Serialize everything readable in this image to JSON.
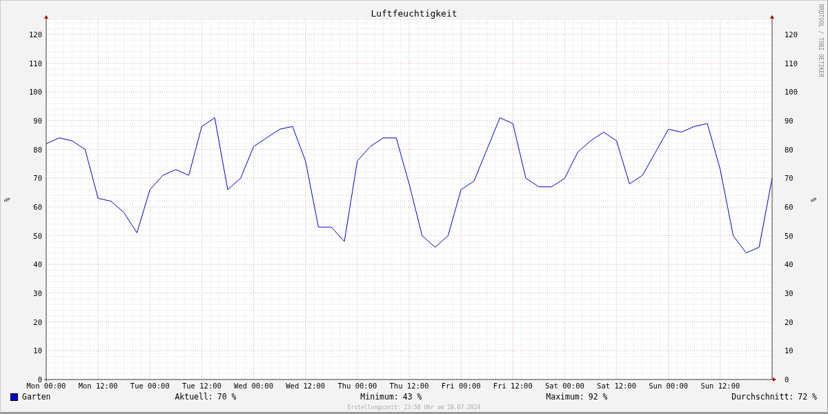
{
  "graph": {
    "title": "Luftfeuchtigkeit",
    "watermark": "RRDTOOL / TOBI OETIKER",
    "right_axis_labels": [
      "120",
      "110",
      "100",
      "90",
      "80",
      "70",
      "60",
      "50",
      "40",
      "30",
      "20",
      "10",
      "0"
    ],
    "chart_data": {
      "type": "line",
      "grid": true,
      "ylabel": "%",
      "ylim": [
        0,
        125
      ],
      "yticks": [
        0,
        10,
        20,
        30,
        40,
        50,
        60,
        70,
        80,
        90,
        100,
        110,
        120
      ],
      "categories": [
        "Mon 00:00",
        null,
        null,
        null,
        "Mon 12:00",
        null,
        null,
        null,
        "Tue 00:00",
        null,
        null,
        null,
        "Tue 12:00",
        null,
        null,
        null,
        "Wed 00:00",
        null,
        null,
        null,
        "Wed 12:00",
        null,
        null,
        null,
        "Thu 00:00",
        null,
        null,
        null,
        "Thu 12:00",
        null,
        null,
        null,
        "Fri 00:00",
        null,
        null,
        null,
        "Fri 12:00",
        null,
        null,
        null,
        "Sat 00:00",
        null,
        null,
        null,
        "Sat 12:00",
        null,
        null,
        null,
        "Sun 00:00",
        null,
        null,
        null,
        "Sun 12:00",
        null,
        null,
        null,
        null
      ],
      "series": [
        {
          "name": "Garten",
          "color": "#0000cc",
          "values": [
            82,
            84,
            83,
            80,
            63,
            62,
            58,
            51,
            66,
            71,
            73,
            71,
            88,
            91,
            66,
            70,
            81,
            84,
            87,
            88,
            76,
            53,
            53,
            48,
            76,
            81,
            84,
            84,
            68,
            50,
            46,
            50,
            66,
            69,
            80,
            91,
            89,
            70,
            67,
            67,
            70,
            79,
            83,
            86,
            83,
            68,
            71,
            79,
            87,
            86,
            88,
            89,
            73,
            50,
            44,
            46,
            70
          ]
        }
      ]
    }
  },
  "legend": {
    "color": "#0000cc",
    "stats": [
      {
        "label": "Aktuell:",
        "value": "70 %"
      },
      {
        "label": "Minimum:",
        "value": "43 %"
      },
      {
        "label": "Maximum:",
        "value": "92 %"
      },
      {
        "label": "Durchschnitt:",
        "value": "72 %"
      }
    ]
  },
  "footer": "Erstellungszeit: 23:58 Uhr am 28.07.2024"
}
